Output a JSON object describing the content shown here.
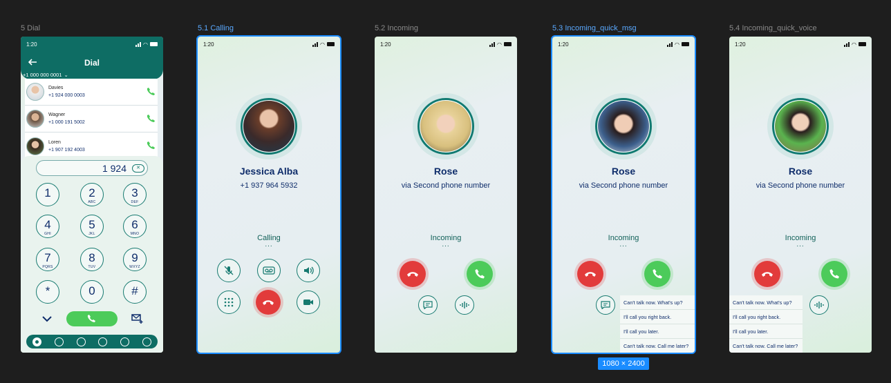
{
  "frame_labels": [
    "5 Dial",
    "5.1 Calling",
    "5.2 Incoming",
    "5.3 Incoming_quick_msg",
    "5.4 Incoming_quick_voice"
  ],
  "status_time": "1:20",
  "dial": {
    "title": "Dial",
    "number_selector": "+1 000 000 0001",
    "contacts": [
      {
        "name": "Davies",
        "number": "+1 924 000 0003"
      },
      {
        "name": "Wagner",
        "number": "+1 000 191 5002"
      },
      {
        "name": "Loren",
        "number": "+1 907 192 4003"
      }
    ],
    "input_value": "1 924",
    "keys": [
      {
        "digit": "1",
        "letters": ""
      },
      {
        "digit": "2",
        "letters": "ABC"
      },
      {
        "digit": "3",
        "letters": "DEF"
      },
      {
        "digit": "4",
        "letters": "GHI"
      },
      {
        "digit": "5",
        "letters": "JKL"
      },
      {
        "digit": "6",
        "letters": "MNO"
      },
      {
        "digit": "7",
        "letters": "PQRS"
      },
      {
        "digit": "8",
        "letters": "TUV"
      },
      {
        "digit": "9",
        "letters": "WXYZ"
      },
      {
        "digit": "*",
        "letters": ""
      },
      {
        "digit": "0",
        "letters": ""
      },
      {
        "digit": "#",
        "letters": ""
      }
    ]
  },
  "calling": {
    "name": "Jessica Alba",
    "number": "+1 937 964 5932",
    "state": "Calling",
    "dots": "..."
  },
  "incoming": {
    "name": "Rose",
    "via": "via Second phone number",
    "state": "Incoming",
    "dots": "..."
  },
  "quick_messages": [
    "Can't talk now. What's up?",
    "I'll call you right back.",
    "I'll call you later.",
    "Can't talk now. Call me later?"
  ],
  "selection_size": "1080 × 2400",
  "colors": {
    "primary": "#0e6d64",
    "accept": "#4ccb5a",
    "decline": "#e23b3b",
    "selection": "#1a8cff"
  }
}
